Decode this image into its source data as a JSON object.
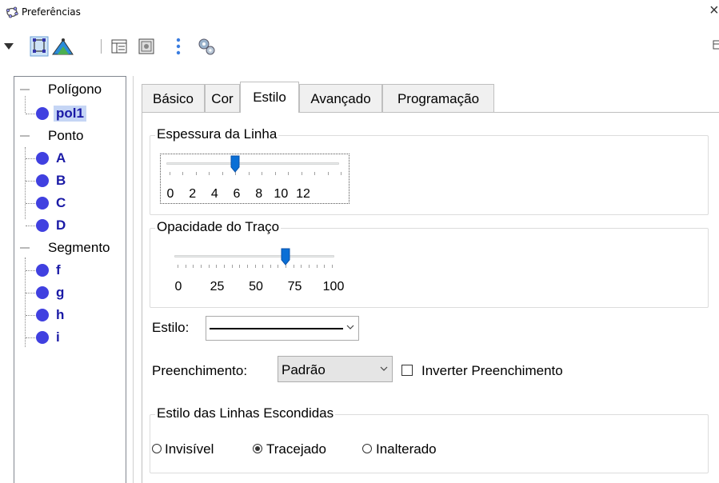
{
  "window": {
    "title": "Preferências",
    "close_glyph": "×"
  },
  "toolbar": {
    "icons": [
      "dropdown-arrow-icon",
      "polygon-select-icon",
      "triangle-icon",
      "layout-icon",
      "graphics-icon",
      "more-dots-icon",
      "gear-icon"
    ]
  },
  "tree": {
    "categories": [
      {
        "label": "Polígono",
        "items": [
          "pol1"
        ],
        "selected": "pol1"
      },
      {
        "label": "Ponto",
        "items": [
          "A",
          "B",
          "C",
          "D"
        ]
      },
      {
        "label": "Segmento",
        "items": [
          "f",
          "g",
          "h",
          "i"
        ]
      }
    ]
  },
  "tabs": {
    "basico": "Básico",
    "cor": "Cor",
    "estilo": "Estilo",
    "avancado": "Avançado",
    "programacao": "Programação",
    "active": "Estilo"
  },
  "espessura": {
    "title": "Espessura da Linha",
    "value": 5,
    "min": 0,
    "max": 13,
    "tick_labels": [
      "0",
      "2",
      "4",
      "6",
      "8",
      "10",
      "12"
    ]
  },
  "opacidade": {
    "title": "Opacidade do Traço",
    "value": 70,
    "min": 0,
    "max": 100,
    "tick_labels": [
      "0",
      "25",
      "50",
      "75",
      "100"
    ]
  },
  "estilo": {
    "label": "Estilo:",
    "selected": "solid-line"
  },
  "preenchimento": {
    "label": "Preenchimento:",
    "value": "Padrão",
    "invert_label": "Inverter Preenchimento",
    "invert_checked": false
  },
  "linhas_escondidas": {
    "title": "Estilo das Linhas Escondidas",
    "options": [
      "Invisível",
      "Tracejado",
      "Inalterado"
    ],
    "selected": "Tracejado"
  },
  "colors": {
    "object_blue": "#1a1aa6",
    "dot_blue": "#4040e0",
    "selection": "#c5d5f5",
    "slider_thumb": "#0a6fd6"
  }
}
